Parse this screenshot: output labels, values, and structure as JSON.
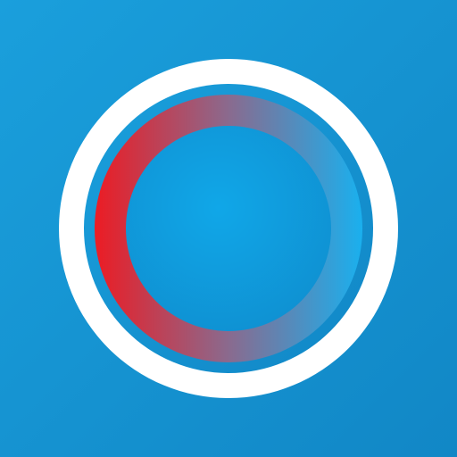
{
  "icon": {
    "name": "ring-logo-icon",
    "colors": {
      "background_light": "#1a9fdc",
      "background_dark": "#1187c6",
      "outer_ring": "#ffffff",
      "gradient_start": "#ec1c24",
      "gradient_mid": "#8a6a8e",
      "gradient_end": "#1ab0ee",
      "inner_light": "#10a7e8",
      "inner_dark": "#0f8fd0"
    }
  }
}
